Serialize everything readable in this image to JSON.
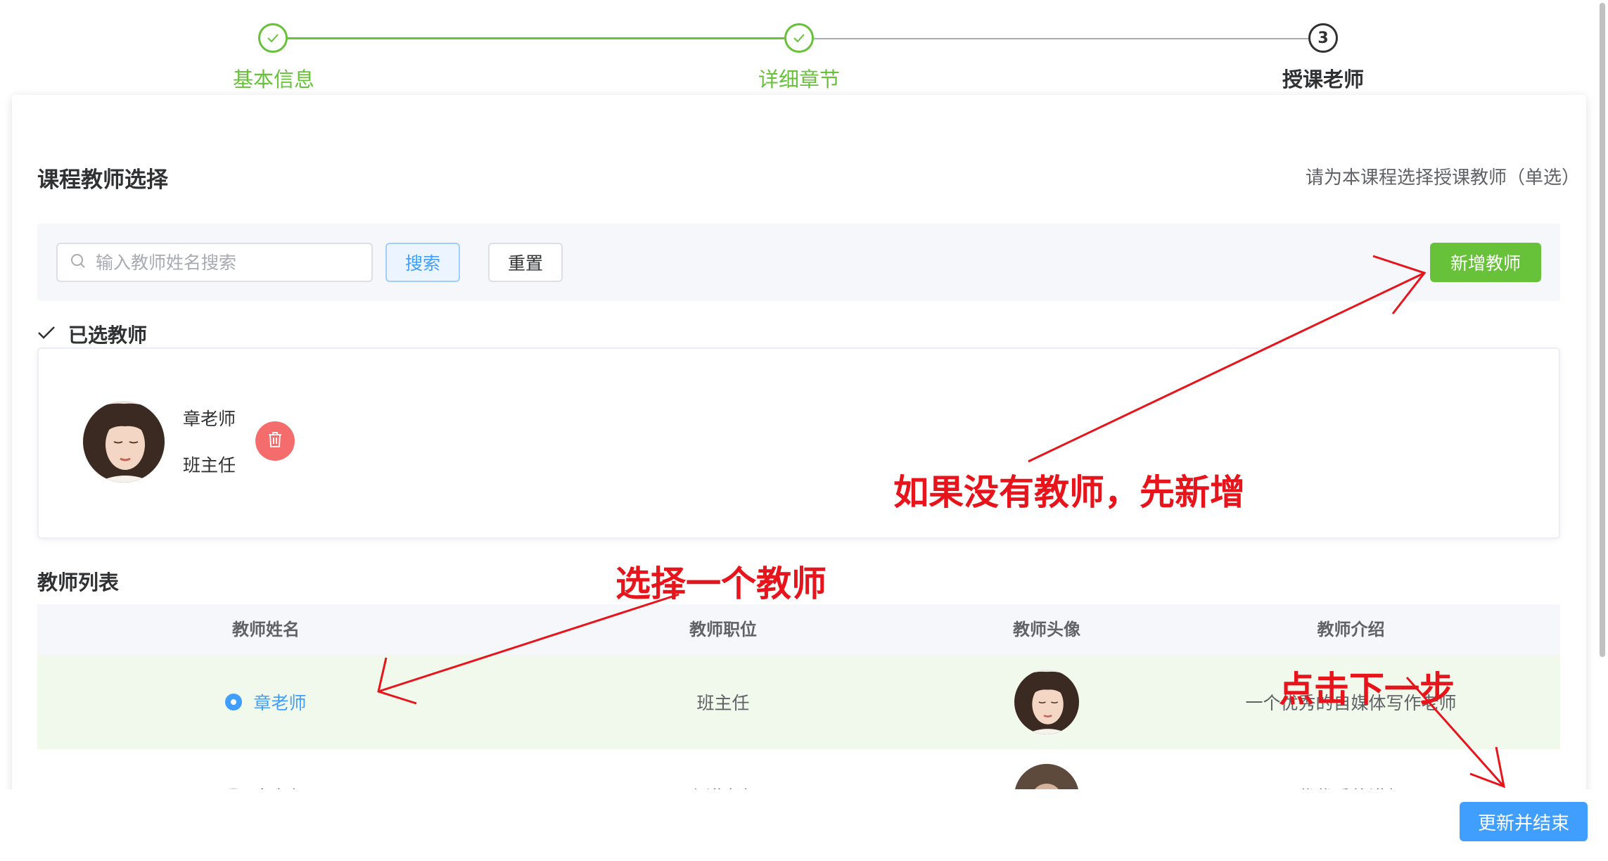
{
  "steps": [
    {
      "title": "基本信息",
      "status": "finished"
    },
    {
      "title": "详细章节",
      "status": "finished"
    },
    {
      "title": "授课老师",
      "status": "active",
      "number": "3"
    }
  ],
  "section": {
    "title": "课程教师选择",
    "hint": "请为本课程选择授课教师（单选）"
  },
  "toolbar": {
    "search_placeholder": "输入教师姓名搜索",
    "search_value": "",
    "search_button": "搜索",
    "reset_button": "重置",
    "add_button": "新增教师"
  },
  "selected": {
    "title": "已选教师",
    "teacher_name": "章老师",
    "teacher_position": "班主任"
  },
  "teacher_list": {
    "title": "教师列表",
    "columns": [
      "教师姓名",
      "教师职位",
      "教师头像",
      "教师介绍"
    ],
    "rows": [
      {
        "name": "章老师",
        "position": "班主任",
        "intro": "一个优秀的自媒体写作老师",
        "selected": true
      },
      {
        "name": "章老师",
        "position": "主讲老师",
        "intro": "优优秀的讲师",
        "selected": false
      }
    ]
  },
  "footer": {
    "finish_button": "更新并结束"
  },
  "annotations": {
    "add_hint": "如果没有教师，先新增",
    "select_hint": "选择一个教师",
    "next_hint": "点击下一步"
  },
  "colors": {
    "success": "#67c23a",
    "primary": "#409eff",
    "danger": "#f56c6c",
    "annotation": "#e8141b"
  }
}
